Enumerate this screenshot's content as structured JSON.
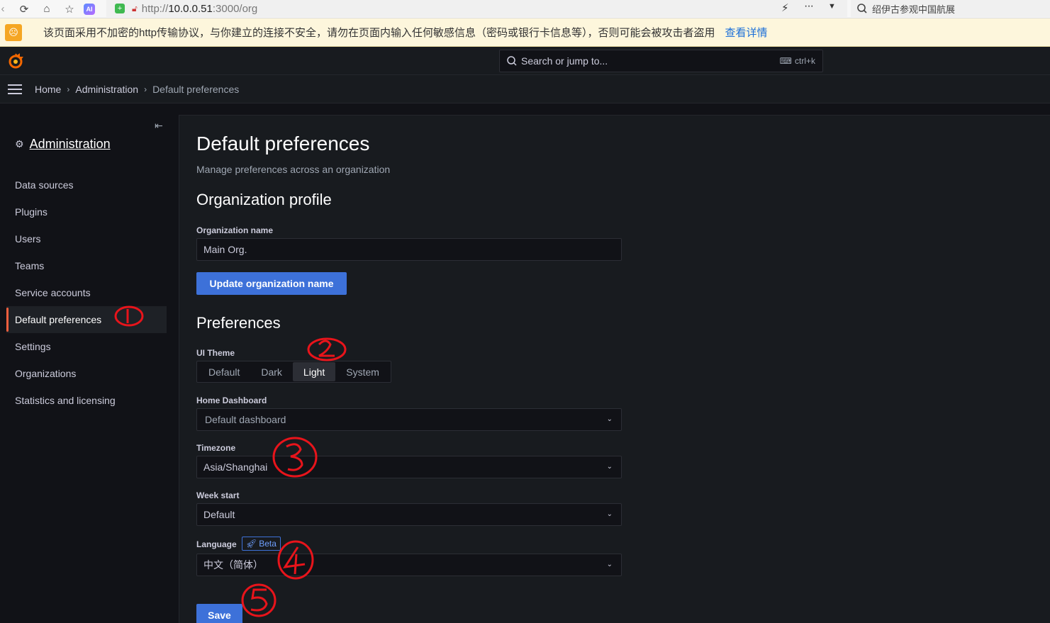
{
  "browser": {
    "url_prefix": "http://",
    "url_host": "10.0.0.51",
    "url_rest": ":3000/org",
    "search_text": "绍伊古参观中国航展",
    "ai_label": "AI"
  },
  "warning": {
    "text": "该页面采用不加密的http传输协议，与你建立的连接不安全，请勿在页面内输入任何敏感信息（密码或银行卡信息等），否则可能会被攻击者盗用",
    "link": "查看详情"
  },
  "topbar": {
    "search_placeholder": "Search or jump to...",
    "shortcut": "ctrl+k"
  },
  "breadcrumb": {
    "items": [
      "Home",
      "Administration",
      "Default preferences"
    ]
  },
  "sidebar": {
    "section_title": "Administration",
    "items": [
      {
        "label": "Data sources"
      },
      {
        "label": "Plugins"
      },
      {
        "label": "Users"
      },
      {
        "label": "Teams"
      },
      {
        "label": "Service accounts"
      },
      {
        "label": "Default preferences",
        "active": true
      },
      {
        "label": "Settings"
      },
      {
        "label": "Organizations"
      },
      {
        "label": "Statistics and licensing"
      }
    ]
  },
  "page": {
    "title": "Default preferences",
    "subtitle": "Manage preferences across an organization"
  },
  "org_profile": {
    "heading": "Organization profile",
    "name_label": "Organization name",
    "name_value": "Main Org.",
    "update_button": "Update organization name"
  },
  "preferences": {
    "heading": "Preferences",
    "theme_label": "UI Theme",
    "theme_options": [
      "Default",
      "Dark",
      "Light",
      "System"
    ],
    "theme_selected": "Light",
    "home_label": "Home Dashboard",
    "home_value": "Default dashboard",
    "timezone_label": "Timezone",
    "timezone_value": "Asia/Shanghai",
    "week_label": "Week start",
    "week_value": "Default",
    "language_label": "Language",
    "beta_label": "Beta",
    "language_value": "中文（简体）",
    "save_button": "Save"
  },
  "colors": {
    "accent": "#3d71d9",
    "active_bar": "#f55f3e",
    "annotation": "#e8141b"
  },
  "annotations": [
    "1",
    "2",
    "3",
    "4",
    "5"
  ]
}
